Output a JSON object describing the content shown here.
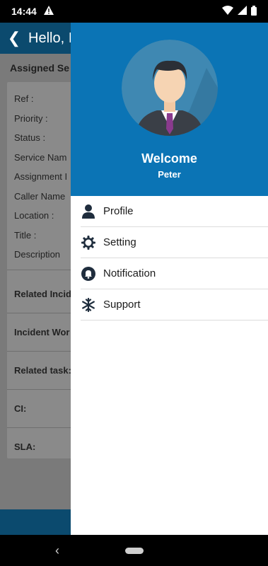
{
  "status": {
    "time": "14:44",
    "warning_icon": "warning-icon",
    "wifi_icon": "wifi-icon",
    "signal_icon": "signal-icon",
    "battery_icon": "battery-icon"
  },
  "background": {
    "title": "Hello, I",
    "subtitle": "Assigned Se",
    "fields": [
      "Ref :",
      "Priority :",
      "Status :",
      "Service Nam",
      "Assignment I",
      "Caller Name",
      "Location :",
      "Title :",
      "Description"
    ],
    "sections": [
      "Related Incid",
      "Incident Wor",
      "Related task:",
      "CI:",
      "SLA:"
    ]
  },
  "drawer": {
    "welcome": "Welcome",
    "user_name": "Peter",
    "menu": [
      {
        "label": "Profile",
        "icon": "person-icon"
      },
      {
        "label": "Setting",
        "icon": "gear-icon"
      },
      {
        "label": "Notification",
        "icon": "bell-icon"
      },
      {
        "label": "Support",
        "icon": "snowflake-icon"
      }
    ],
    "header_color": "#0b74b5"
  },
  "navigation": {
    "back_icon": "nav-back-icon",
    "home_icon": "home-pill-icon"
  }
}
